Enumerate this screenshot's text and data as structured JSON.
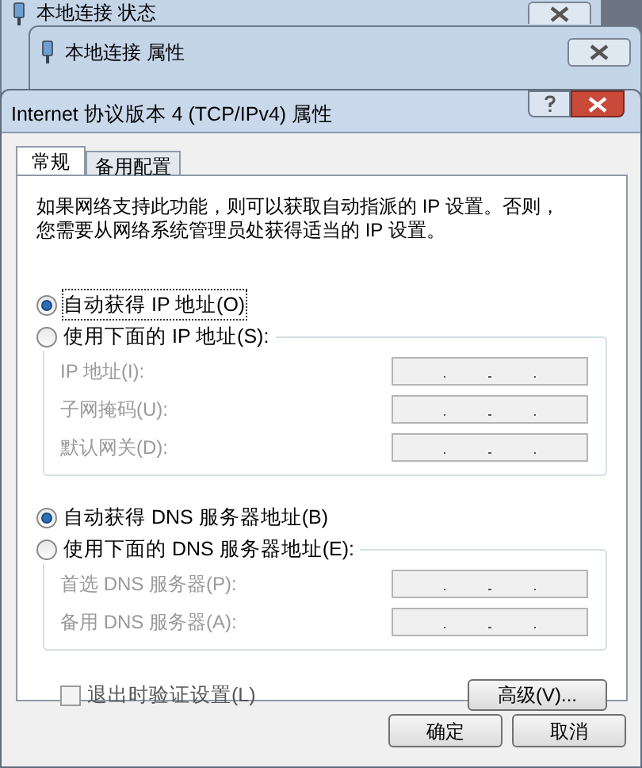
{
  "background_windows": [
    {
      "title": "本地连接 状态"
    },
    {
      "title": "本地连接 属性"
    }
  ],
  "dialog": {
    "title": "Internet 协议版本 4 (TCP/IPv4) 属性",
    "tabs": [
      {
        "label": "常规",
        "selected": true
      },
      {
        "label": "备用配置",
        "selected": false
      }
    ],
    "description_lines": [
      "如果网络支持此功能，则可以获取自动指派的 IP 设置。否则，",
      "您需要从网络系统管理员处获得适当的 IP 设置。"
    ],
    "sections": [
      {
        "options": [
          {
            "label": "自动获得 IP 地址(O)",
            "selected": true
          },
          {
            "label": "使用下面的 IP 地址(S):",
            "selected": false
          }
        ],
        "fields": [
          {
            "label": "IP 地址(I):",
            "disabled": true
          },
          {
            "label": "子网掩码(U):",
            "disabled": true
          },
          {
            "label": "默认网关(D):",
            "disabled": true
          }
        ]
      },
      {
        "options": [
          {
            "label": "自动获得 DNS 服务器地址(B)",
            "selected": true
          },
          {
            "label": "使用下面的 DNS 服务器地址(E):",
            "selected": false
          }
        ],
        "fields": [
          {
            "label": "首选 DNS 服务器(P):",
            "disabled": true
          },
          {
            "label": "备用 DNS 服务器(A):",
            "disabled": true
          }
        ]
      }
    ],
    "checkbox": {
      "label": "退出时验证设置(L)",
      "checked": false
    },
    "advanced_button": "高级(V)...",
    "buttons": [
      "确定",
      "取消"
    ]
  }
}
